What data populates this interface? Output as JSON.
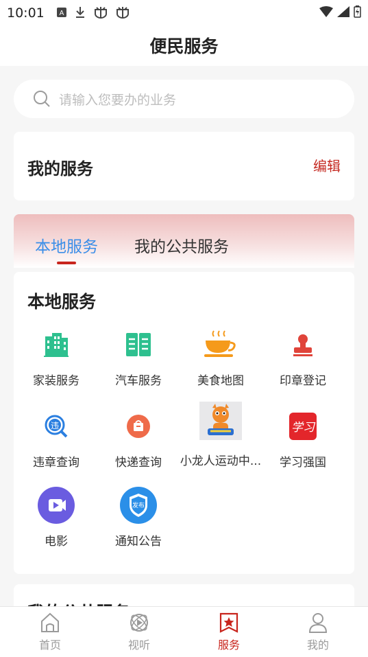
{
  "status_bar": {
    "time": "10:01",
    "icons": [
      "notification-a-icon",
      "download-icon",
      "bug-icon",
      "bug-icon"
    ],
    "right_icons": [
      "wifi-icon",
      "signal-icon",
      "battery-charging-icon"
    ]
  },
  "header": {
    "title": "便民服务"
  },
  "search": {
    "placeholder": "请输入您要办的业务",
    "icon": "search-icon"
  },
  "my_services": {
    "title": "我的服务",
    "edit_label": "编辑"
  },
  "tabs": [
    {
      "label": "本地服务",
      "active": true
    },
    {
      "label": "我的公共服务",
      "active": false
    }
  ],
  "local_services": {
    "title": "本地服务",
    "items": [
      {
        "label": "家装服务",
        "icon": "building-icon",
        "color": "#2ec08f"
      },
      {
        "label": "汽车服务",
        "icon": "book-icon",
        "color": "#2ec08f"
      },
      {
        "label": "美食地图",
        "icon": "coffee-cup-icon",
        "color": "#f59a1b"
      },
      {
        "label": "印章登记",
        "icon": "stamp-icon",
        "color": "#e0443a"
      },
      {
        "label": "违章查询",
        "icon": "violation-search-icon",
        "color": "#2b7fe0"
      },
      {
        "label": "快递查询",
        "icon": "parcel-icon",
        "color": "#ef6b4a"
      },
      {
        "label": "小龙人运动中...",
        "icon": "dragon-mascot-icon",
        "color": "#f08a2a"
      },
      {
        "label": "学习强国",
        "icon": "xuexi-logo-icon",
        "color": "#e3262b"
      },
      {
        "label": "电影",
        "icon": "video-play-icon",
        "color": "#6a5ce0"
      },
      {
        "label": "通知公告",
        "icon": "announcement-shield-icon",
        "color": "#2b8fe8"
      }
    ]
  },
  "public_services": {
    "title": "我的公共服务"
  },
  "bottom_nav": [
    {
      "label": "首页",
      "icon": "home-icon",
      "active": false
    },
    {
      "label": "视听",
      "icon": "media-play-icon",
      "active": false
    },
    {
      "label": "服务",
      "icon": "star-bookmark-icon",
      "active": true
    },
    {
      "label": "我的",
      "icon": "person-icon",
      "active": false
    }
  ],
  "colors": {
    "accent_red": "#c8251d",
    "tab_active_blue": "#3a8ee8",
    "nav_inactive": "#9a9a9a"
  }
}
